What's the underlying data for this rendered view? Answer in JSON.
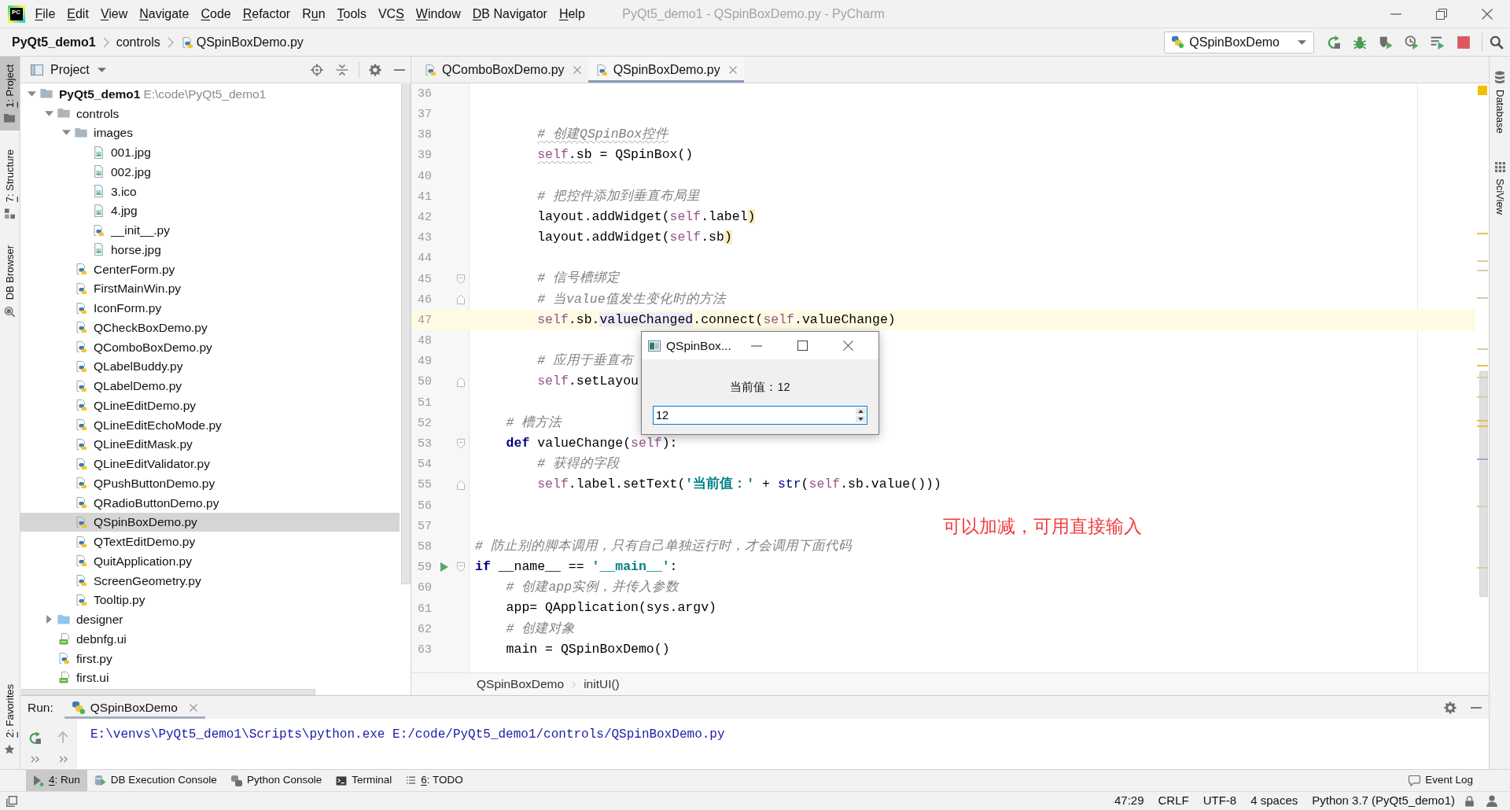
{
  "window": {
    "logo": "PC",
    "title": "PyQt5_demo1 - QSpinBoxDemo.py - PyCharm"
  },
  "menu": [
    {
      "key": "F",
      "tail": "ile"
    },
    {
      "key": "E",
      "tail": "dit"
    },
    {
      "key": "V",
      "tail": "iew"
    },
    {
      "key": "N",
      "tail": "avigate"
    },
    {
      "key": "C",
      "tail": "ode"
    },
    {
      "key": "R",
      "tail": "efactor"
    },
    {
      "lead": "R",
      "key": "u",
      "tail": "n"
    },
    {
      "key": "T",
      "tail": "ools"
    },
    {
      "lead": "VC",
      "key": "S"
    },
    {
      "key": "W",
      "tail": "indow"
    },
    {
      "key": "D",
      "tail": "B Navigator"
    },
    {
      "key": "H",
      "tail": "elp"
    }
  ],
  "breadcrumb": [
    {
      "label": "PyQt5_demo1",
      "kind": "project"
    },
    {
      "label": "controls",
      "kind": "dir"
    },
    {
      "label": "QSpinBoxDemo.py",
      "kind": "python"
    }
  ],
  "run_config": {
    "label": "QSpinBoxDemo"
  },
  "left_strip": {
    "top": [
      {
        "key": "1",
        "tail": ": Project",
        "kind": "project",
        "selected": true
      },
      {
        "key": "7",
        "tail": ": Structure",
        "kind": "structure",
        "selected": false
      },
      {
        "label": "DB Browser",
        "kind": "db-browser",
        "selected": false
      }
    ],
    "bottom": [
      {
        "key": "2",
        "tail": ": Favorites",
        "kind": "favorites",
        "selected": false
      }
    ]
  },
  "project_panel": {
    "title": "Project",
    "tree": [
      {
        "name": "PyQt5_demo1",
        "path": "E:\\code\\PyQt5_demo1",
        "kind": "project",
        "expanded": true,
        "selected": false,
        "children": [
          {
            "name": "controls",
            "kind": "dir",
            "expanded": true,
            "selected": false,
            "children": [
              {
                "name": "images",
                "kind": "dir",
                "expanded": true,
                "selected": false,
                "children": [
                  {
                    "name": "001.jpg",
                    "kind": "image",
                    "selected": false
                  },
                  {
                    "name": "002.jpg",
                    "kind": "image",
                    "selected": false
                  },
                  {
                    "name": "3.ico",
                    "kind": "image",
                    "selected": false
                  },
                  {
                    "name": "4.jpg",
                    "kind": "image",
                    "selected": false
                  },
                  {
                    "name": "__init__.py",
                    "kind": "python",
                    "selected": false
                  },
                  {
                    "name": "horse.jpg",
                    "kind": "image",
                    "selected": false
                  }
                ]
              },
              {
                "name": "CenterForm.py",
                "kind": "python",
                "selected": false
              },
              {
                "name": "FirstMainWin.py",
                "kind": "python",
                "selected": false
              },
              {
                "name": "IconForm.py",
                "kind": "python",
                "selected": false
              },
              {
                "name": "QCheckBoxDemo.py",
                "kind": "python",
                "selected": false
              },
              {
                "name": "QComboBoxDemo.py",
                "kind": "python",
                "selected": false
              },
              {
                "name": "QLabelBuddy.py",
                "kind": "python",
                "selected": false
              },
              {
                "name": "QLabelDemo.py",
                "kind": "python",
                "selected": false
              },
              {
                "name": "QLineEditDemo.py",
                "kind": "python",
                "selected": false
              },
              {
                "name": "QLineEditEchoMode.py",
                "kind": "python",
                "selected": false
              },
              {
                "name": "QLineEditMask.py",
                "kind": "python",
                "selected": false
              },
              {
                "name": "QLineEditValidator.py",
                "kind": "python",
                "selected": false
              },
              {
                "name": "QPushButtonDemo.py",
                "kind": "python",
                "selected": false
              },
              {
                "name": "QRadioButtonDemo.py",
                "kind": "python",
                "selected": false
              },
              {
                "name": "QSpinBoxDemo.py",
                "kind": "python",
                "selected": true
              },
              {
                "name": "QTextEditDemo.py",
                "kind": "python",
                "selected": false
              },
              {
                "name": "QuitApplication.py",
                "kind": "python",
                "selected": false
              },
              {
                "name": "ScreenGeometry.py",
                "kind": "python",
                "selected": false
              },
              {
                "name": "Tooltip.py",
                "kind": "python",
                "selected": false
              }
            ]
          },
          {
            "name": "designer",
            "kind": "source-dir",
            "expanded": false,
            "selected": false
          },
          {
            "name": "debnfg.ui",
            "kind": "ui",
            "selected": false
          },
          {
            "name": "first.py",
            "kind": "python",
            "selected": false
          },
          {
            "name": "first.ui",
            "kind": "ui",
            "selected": false
          }
        ]
      }
    ]
  },
  "editor": {
    "tabs": [
      {
        "label": "QComboBoxDemo.py",
        "selected": false
      },
      {
        "label": "QSpinBoxDemo.py",
        "selected": true
      }
    ],
    "lines": [
      {
        "number": "36",
        "kind": "plain",
        "current": false
      },
      {
        "number": "37",
        "kind": "plain",
        "current": false
      },
      {
        "number": "38",
        "kind": "plain",
        "current": false,
        "tokens": [
          {
            "kind": "comment-warn",
            "text": "        # 创建QSpinBox控件"
          }
        ]
      },
      {
        "number": "39",
        "kind": "plain",
        "current": false,
        "tokens": [
          {
            "kind": "self-warn",
            "text": "        self"
          },
          {
            "kind": "plain-warn",
            "text": ".sb"
          },
          {
            "kind": "plain",
            "text": " = QSpinBox()"
          }
        ]
      },
      {
        "number": "40",
        "kind": "plain",
        "current": false
      },
      {
        "number": "41",
        "kind": "plain",
        "current": false,
        "tokens": [
          {
            "kind": "comment",
            "text": "        # 把控件添加到垂直布局里"
          }
        ]
      },
      {
        "number": "42",
        "kind": "plain",
        "current": false,
        "tokens": [
          {
            "kind": "plain",
            "text": "        layout.addWidget("
          },
          {
            "kind": "self",
            "text": "self"
          },
          {
            "kind": "plain",
            "text": ".label"
          },
          {
            "kind": "match",
            "text": ")"
          }
        ]
      },
      {
        "number": "43",
        "kind": "plain",
        "current": false,
        "tokens": [
          {
            "kind": "plain",
            "text": "        layout.addWidget("
          },
          {
            "kind": "self",
            "text": "self"
          },
          {
            "kind": "plain",
            "text": ".sb"
          },
          {
            "kind": "match",
            "text": ")"
          }
        ]
      },
      {
        "number": "44",
        "kind": "plain",
        "current": false
      },
      {
        "number": "45",
        "kind": "foldstart",
        "current": false,
        "tokens": [
          {
            "kind": "comment",
            "text": "        # 信号槽绑定"
          }
        ]
      },
      {
        "number": "46",
        "kind": "foldend",
        "current": false,
        "tokens": [
          {
            "kind": "comment",
            "text": "        # 当value值发生变化时的方法"
          }
        ]
      },
      {
        "number": "47",
        "kind": "plain",
        "current": true,
        "tokens": [
          {
            "kind": "self",
            "text": "        self"
          },
          {
            "kind": "plain",
            "text": ".sb."
          },
          {
            "kind": "usage",
            "text": "valueChanged"
          },
          {
            "kind": "plain",
            "text": ".connect("
          },
          {
            "kind": "self",
            "text": "self"
          },
          {
            "kind": "plain",
            "text": ".valueChange)"
          }
        ]
      },
      {
        "number": "48",
        "kind": "plain",
        "current": false
      },
      {
        "number": "49",
        "kind": "plain",
        "current": false,
        "tokens": [
          {
            "kind": "comment",
            "text": "        # 应用于垂直布"
          }
        ]
      },
      {
        "number": "50",
        "kind": "foldend",
        "current": false,
        "tokens": [
          {
            "kind": "self",
            "text": "        self"
          },
          {
            "kind": "plain",
            "text": ".setLayou"
          }
        ]
      },
      {
        "number": "51",
        "kind": "plain",
        "current": false
      },
      {
        "number": "52",
        "kind": "plain",
        "current": false,
        "tokens": [
          {
            "kind": "comment",
            "text": "    # 槽方法"
          }
        ]
      },
      {
        "number": "53",
        "kind": "foldstart",
        "current": false,
        "tokens": [
          {
            "kind": "keyword",
            "text": "    def"
          },
          {
            "kind": "plain",
            "text": " valueChange("
          },
          {
            "kind": "self",
            "text": "self"
          },
          {
            "kind": "plain",
            "text": "):"
          }
        ]
      },
      {
        "number": "54",
        "kind": "plain",
        "current": false,
        "tokens": [
          {
            "kind": "comment",
            "text": "        # 获得的字段"
          }
        ]
      },
      {
        "number": "55",
        "kind": "foldend",
        "current": false,
        "tokens": [
          {
            "kind": "self",
            "text": "        self"
          },
          {
            "kind": "plain",
            "text": ".label.setText("
          },
          {
            "kind": "string",
            "text": "'当前值：'"
          },
          {
            "kind": "plain",
            "text": " + "
          },
          {
            "kind": "builtin",
            "text": "str"
          },
          {
            "kind": "plain",
            "text": "("
          },
          {
            "kind": "self",
            "text": "self"
          },
          {
            "kind": "plain",
            "text": ".sb.value()))"
          }
        ]
      },
      {
        "number": "56",
        "kind": "plain",
        "current": false
      },
      {
        "number": "57",
        "kind": "plain",
        "current": false
      },
      {
        "number": "58",
        "kind": "plain",
        "current": false,
        "tokens": [
          {
            "kind": "comment",
            "text": "# 防止别的脚本调用，只有自己单独运行时，才会调用下面代码"
          }
        ]
      },
      {
        "number": "59",
        "kind": "runnable",
        "current": false,
        "tokens": [
          {
            "kind": "keyword",
            "text": "if"
          },
          {
            "kind": "plain",
            "text": " __name__ == "
          },
          {
            "kind": "string",
            "text": "'__main__'"
          },
          {
            "kind": "plain",
            "text": ":"
          }
        ]
      },
      {
        "number": "60",
        "kind": "plain",
        "current": false,
        "tokens": [
          {
            "kind": "comment",
            "text": "    # 创建app实例，并传入参数"
          }
        ]
      },
      {
        "number": "61",
        "kind": "plain",
        "current": false,
        "tokens": [
          {
            "kind": "plain",
            "text": "    app= QApplication(sys.argv)"
          }
        ]
      },
      {
        "number": "62",
        "kind": "plain",
        "current": false,
        "tokens": [
          {
            "kind": "comment",
            "text": "    # 创建对象"
          }
        ]
      },
      {
        "number": "63",
        "kind": "plain",
        "current": false,
        "tokens": [
          {
            "kind": "plain",
            "text": "    main = QSpinBoxDemo()"
          }
        ]
      }
    ],
    "breadcrumb": [
      "QSpinBoxDemo",
      "initUI()"
    ],
    "annotation": "可以加减，可用直接输入"
  },
  "dialog": {
    "title": "QSpinBox...",
    "label": "当前值：12",
    "value": "12"
  },
  "right_strip": [
    {
      "label": "Database",
      "kind": "database"
    },
    {
      "label": "SciView",
      "kind": "sciview"
    }
  ],
  "run_panel": {
    "label": "Run:",
    "tabs": [
      {
        "label": "QSpinBoxDemo",
        "selected": true
      }
    ],
    "output": "E:\\venvs\\PyQt5_demo1\\Scripts\\python.exe E:/code/PyQt5_demo1/controls/QSpinBoxDemo.py"
  },
  "bottom_tabs": [
    {
      "key": "4",
      "tail": ": Run",
      "kind": "run",
      "selected": true
    },
    {
      "label": "DB Execution Console",
      "kind": "db-console",
      "selected": false
    },
    {
      "label": "Python Console",
      "kind": "python",
      "selected": false
    },
    {
      "label": "Terminal",
      "kind": "terminal",
      "selected": false
    },
    {
      "key": "6",
      "tail": ": TODO",
      "kind": "todo",
      "selected": false
    }
  ],
  "event_log": "Event Log",
  "status_bar": [
    "47:29",
    "CRLF",
    "UTF-8",
    "4 spaces",
    "Python 3.7 (PyQt5_demo1)"
  ]
}
